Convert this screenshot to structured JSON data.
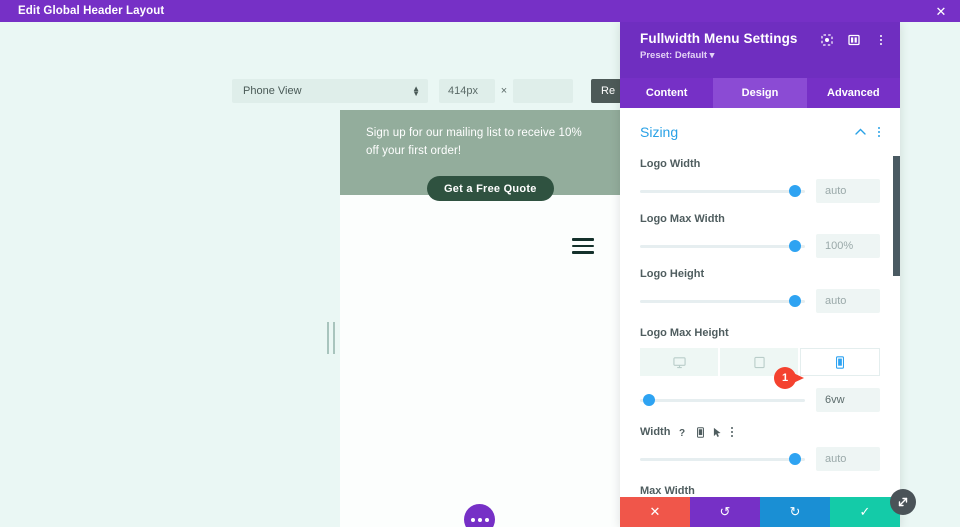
{
  "topbar": {
    "title": "Edit Global Header Layout",
    "close_label": "✕"
  },
  "responsive_toolbar": {
    "view_mode": "Phone View",
    "width_value": "414px",
    "multiply_symbol": "×",
    "height_value": "",
    "reset_label": "Re"
  },
  "preview": {
    "promo_text": "Sign up for our mailing list to receive  10% off your first order!",
    "promo_button": "Get a Free Quote",
    "menu_icon": "hamburger-icon",
    "fab_icon": "ellipsis-icon"
  },
  "panel": {
    "title": "Fullwidth Menu Settings",
    "preset": "Preset: Default ▾",
    "head_icons": [
      {
        "name": "focus-target-icon",
        "glyph": "⦿"
      },
      {
        "name": "split-layout-icon",
        "glyph": "◫"
      },
      {
        "name": "overflow-menu-icon",
        "glyph": "⋮"
      }
    ],
    "tabs": [
      {
        "label": "Content",
        "active": false
      },
      {
        "label": "Design",
        "active": true
      },
      {
        "label": "Advanced",
        "active": false
      }
    ],
    "section": {
      "title": "Sizing",
      "collapse_icon": "⌃",
      "menu_icon": "⋮"
    },
    "fields": [
      {
        "label": "Logo Width",
        "value": "auto",
        "placeholder": "auto",
        "knob_pct": 90
      },
      {
        "label": "Logo Max Width",
        "value": "100%",
        "placeholder": "100%",
        "knob_pct": 90
      },
      {
        "label": "Logo Height",
        "value": "auto",
        "placeholder": "auto",
        "knob_pct": 90
      }
    ],
    "logo_max_height": {
      "label": "Logo Max Height",
      "devices": [
        {
          "name": "desktop",
          "glyph": "Ὓ5",
          "active": false
        },
        {
          "name": "tablet",
          "glyph": "▢",
          "active": false
        },
        {
          "name": "phone",
          "glyph": "▯",
          "active": true
        }
      ],
      "value": "6vw",
      "knob_pct": 2,
      "callout_number": "1"
    },
    "width_field": {
      "label": "Width",
      "icons": [
        {
          "name": "help-icon",
          "glyph": "?"
        },
        {
          "name": "responsive-phone-icon",
          "glyph": "▯"
        },
        {
          "name": "hover-cursor-icon",
          "glyph": "➤"
        },
        {
          "name": "overflow-menu-icon",
          "glyph": "⋮"
        }
      ],
      "value": "auto",
      "placeholder": "auto",
      "knob_pct": 90
    },
    "max_width_label": "Max Width",
    "footer": [
      {
        "name": "cancel",
        "glyph": "✕"
      },
      {
        "name": "undo",
        "glyph": "↺"
      },
      {
        "name": "redo",
        "glyph": "↻"
      },
      {
        "name": "save",
        "glyph": "✓"
      }
    ]
  },
  "resize_grip": {
    "icon": "diagonal-resize-icon",
    "glyph": "⤡"
  },
  "colors": {
    "purple": "#7630c6",
    "panel_purple": "#6f2ec0",
    "tab_active": "#8b4bd4",
    "accent_blue": "#2ea3f2",
    "section_blue": "#29a1e6",
    "promo_green": "#93ad9c",
    "promo_btn_green": "#2f5240",
    "callout_red": "#f4422f",
    "save_teal": "#14cba8",
    "cancel_red": "#f0564a",
    "redo_blue": "#1a8fd4",
    "canvas_bg": "#eaf7f4"
  }
}
